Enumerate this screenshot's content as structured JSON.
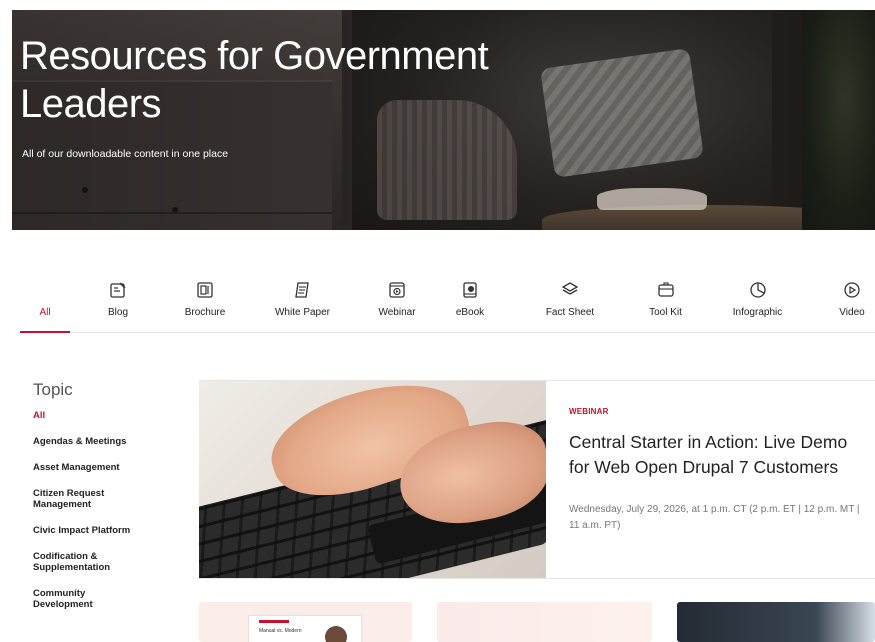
{
  "hero": {
    "title": "Resources for Government Leaders",
    "subtitle": "All of our downloadable content in one place"
  },
  "tabs": [
    {
      "label": "All",
      "icon": "none",
      "active": true
    },
    {
      "label": "Blog",
      "icon": "blog-icon",
      "active": false
    },
    {
      "label": "Brochure",
      "icon": "brochure-icon",
      "active": false
    },
    {
      "label": "White Paper",
      "icon": "white-paper-icon",
      "active": false
    },
    {
      "label": "Webinar",
      "icon": "webinar-icon",
      "active": false
    },
    {
      "label": "eBook",
      "icon": "ebook-icon",
      "active": false
    },
    {
      "label": "Fact Sheet",
      "icon": "fact-sheet-icon",
      "active": false
    },
    {
      "label": "Tool Kit",
      "icon": "tool-kit-icon",
      "active": false
    },
    {
      "label": "Infographic",
      "icon": "infographic-icon",
      "active": false
    },
    {
      "label": "Video",
      "icon": "video-icon",
      "active": false
    }
  ],
  "sidebar": {
    "heading": "Topic",
    "items": [
      {
        "label": "All",
        "active": true
      },
      {
        "label": "Agendas & Meetings",
        "active": false
      },
      {
        "label": "Asset Management",
        "active": false
      },
      {
        "label": "Citizen Request Management",
        "active": false
      },
      {
        "label": "Civic Impact Platform",
        "active": false
      },
      {
        "label": "Codification & Supplementation",
        "active": false
      },
      {
        "label": "Community Development",
        "active": false
      }
    ]
  },
  "featured": {
    "type": "WEBINAR",
    "title": "Central Starter in Action: Live Demo for Web Open Drupal 7 Customers",
    "date": "Wednesday, July 29, 2026, at 1 p.m. CT (2 p.m. ET | 12 p.m. MT | 11 a.m. PT)"
  },
  "cards": {
    "card1_doc_text": "Manual vs. Modern"
  },
  "colors": {
    "accent": "#c8102e",
    "text": "#222222",
    "muted": "#777777"
  }
}
